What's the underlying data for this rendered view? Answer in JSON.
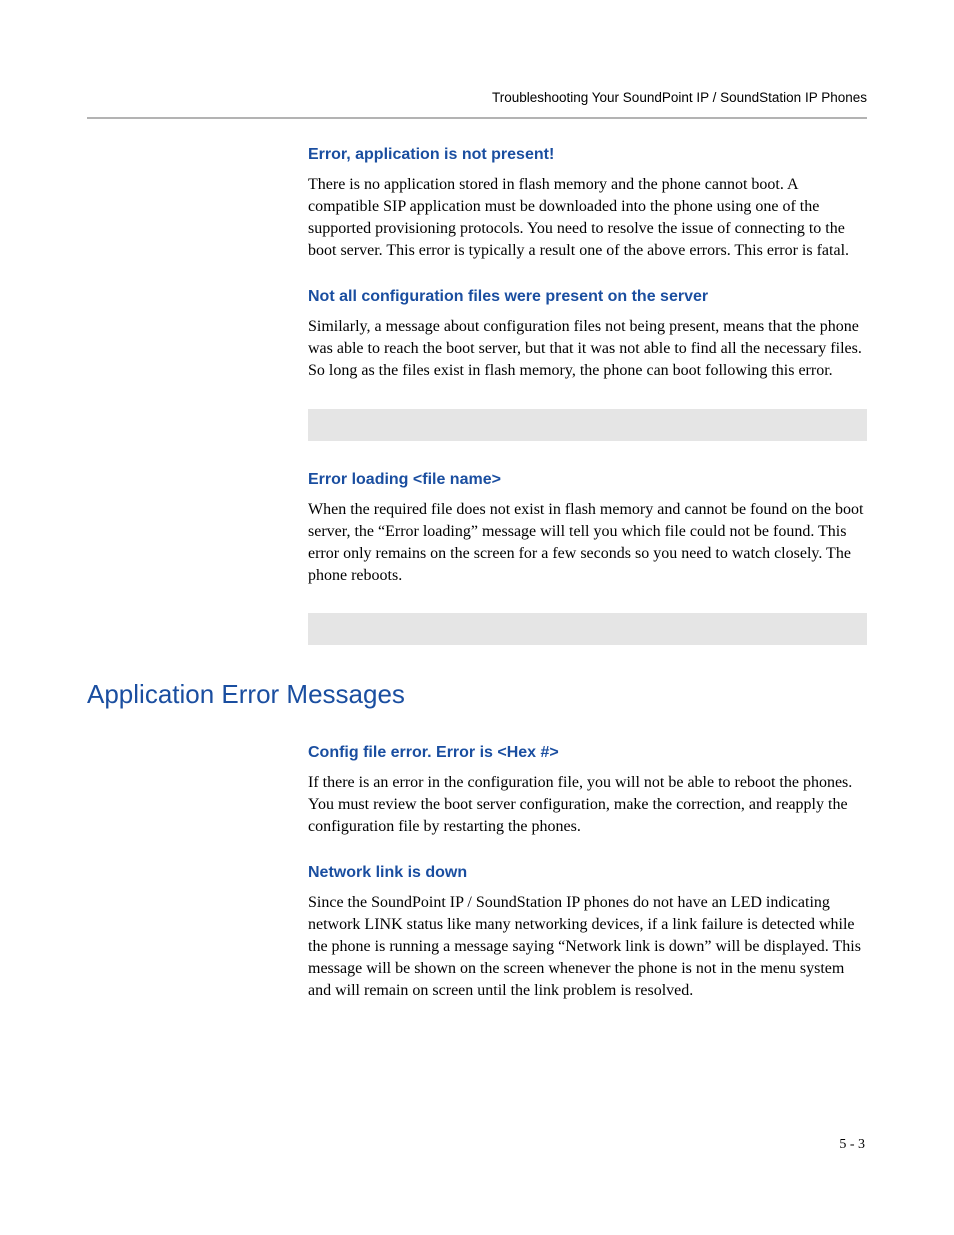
{
  "header": {
    "running_title": "Troubleshooting Your SoundPoint IP / SoundStation IP Phones"
  },
  "sections": {
    "s1": {
      "heading": "Error, application is not present!",
      "body": "There is no application stored in flash memory and the phone cannot boot. A compatible SIP application must be downloaded into the phone using one of the supported provisioning protocols. You need to resolve the issue of connecting to the boot server. This error is typically a result one of the above errors. This error is fatal."
    },
    "s2": {
      "heading": "Not all configuration files were present on the server",
      "body": "Similarly, a message about configuration files not being present, means that the phone was able to reach the boot server, but that it was not able to find all the necessary files. So long as the files exist in flash memory, the phone can boot following this error."
    },
    "s3": {
      "heading": "Error loading <file name>",
      "body": "When the required file does not exist in flash memory and cannot be found on the boot server, the “Error loading” message will tell you which file could not be found. This error only remains on the screen for a few seconds so you need to watch closely. The phone reboots."
    },
    "main_heading": "Application Error Messages",
    "s4": {
      "heading": "Config file error. Error is <Hex #>",
      "body": "If there is an error in the configuration file, you will not be able to reboot the phones. You must review the boot server configuration, make the correction, and reapply the configuration file by restarting the phones."
    },
    "s5": {
      "heading": "Network link is down",
      "body": "Since the SoundPoint IP / SoundStation IP phones do not have an LED indicating network LINK status like many networking devices, if a link failure is detected while the phone is running a message saying “Network link is down” will be displayed. This message will be shown on the screen whenever the phone is not in the menu system and will remain on screen until the link problem is resolved."
    }
  },
  "footer": {
    "page_number": "5 - 3"
  }
}
